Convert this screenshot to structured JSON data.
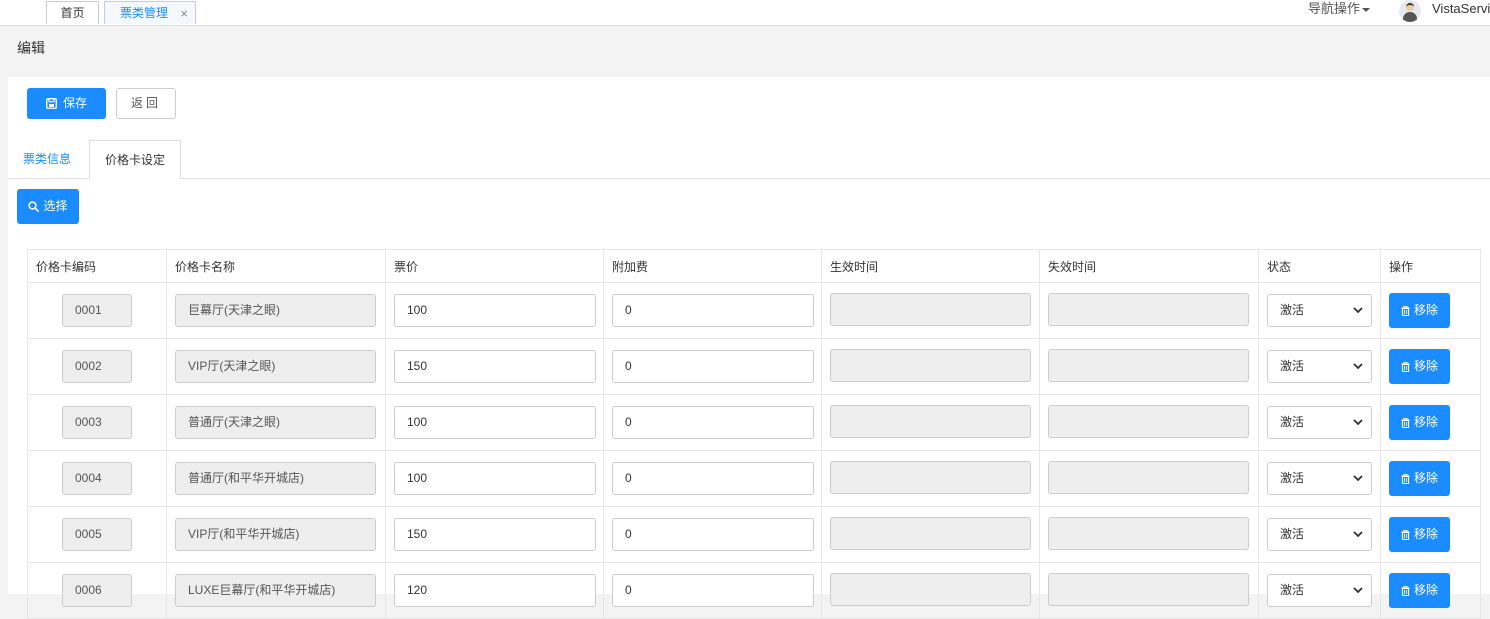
{
  "topbar": {
    "tabs": [
      {
        "label": "首页"
      },
      {
        "label": "票类管理",
        "close": "×"
      }
    ],
    "nav_ops": "导航操作",
    "user": "VistaServic"
  },
  "page": {
    "title": "编辑"
  },
  "toolbar": {
    "save_label": "保存",
    "back_label": "返回"
  },
  "panel_tabs": [
    {
      "label": "票类信息"
    },
    {
      "label": "价格卡设定"
    }
  ],
  "select_button": "选择",
  "colors": {
    "accent": "#1a8cff",
    "readonly_bg": "#eeeeee"
  },
  "table": {
    "headers": [
      "价格卡编码",
      "价格卡名称",
      "票价",
      "附加费",
      "生效时间",
      "失效时间",
      "状态",
      "操作"
    ],
    "remove_label": "移除",
    "rows": [
      {
        "code": "0001",
        "name": "巨幕厅(天津之眼)",
        "price": "100",
        "surcharge": "0",
        "effective": "",
        "expire": "",
        "status": "激活"
      },
      {
        "code": "0002",
        "name": "VIP厅(天津之眼)",
        "price": "150",
        "surcharge": "0",
        "effective": "",
        "expire": "",
        "status": "激活"
      },
      {
        "code": "0003",
        "name": "普通厅(天津之眼)",
        "price": "100",
        "surcharge": "0",
        "effective": "",
        "expire": "",
        "status": "激活"
      },
      {
        "code": "0004",
        "name": "普通厅(和平华开城店)",
        "price": "100",
        "surcharge": "0",
        "effective": "",
        "expire": "",
        "status": "激活"
      },
      {
        "code": "0005",
        "name": "VIP厅(和平华开城店)",
        "price": "150",
        "surcharge": "0",
        "effective": "",
        "expire": "",
        "status": "激活"
      },
      {
        "code": "0006",
        "name": "LUXE巨幕厅(和平华开城店)",
        "price": "120",
        "surcharge": "0",
        "effective": "",
        "expire": "",
        "status": "激活"
      }
    ]
  }
}
